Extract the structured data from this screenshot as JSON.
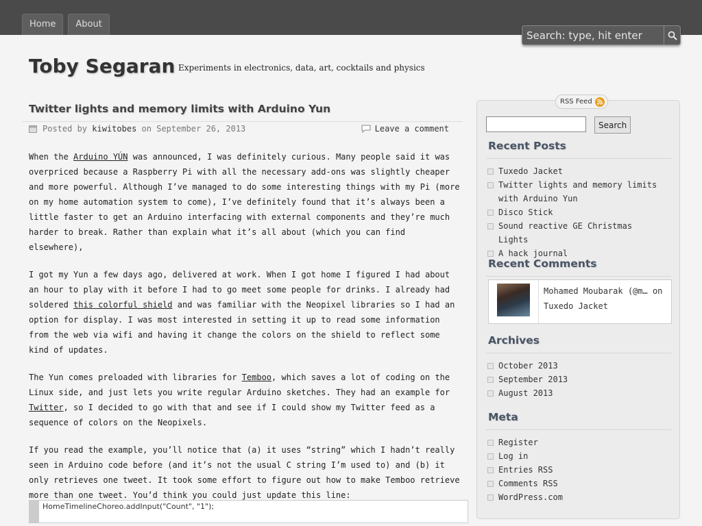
{
  "nav": {
    "tabs": [
      "Home",
      "About"
    ]
  },
  "search": {
    "placeholder": "Search: type, hit enter"
  },
  "site": {
    "title": "Toby Segaran",
    "tagline": "Experiments in electronics, data, art, cocktails and physics"
  },
  "post": {
    "title": "Twitter lights and memory limits with Arduino Yun",
    "meta": {
      "posted_by": "Posted by",
      "author": "kiwitobes",
      "on": "on",
      "date": "September 26, 2013",
      "comment": "Leave a comment"
    },
    "p1": {
      "a": "When the ",
      "link": "Arduino YÚN",
      "b": " was announced, I was definitely curious. Many people said it was overpriced because a Raspberry Pi with all the necessary add-ons was slightly cheaper and more powerful.  Although I’ve managed to do some interesting things with my Pi (more on my home automation system to come), I’ve definitely found that it’s always been a little faster to get an Arduino interfacing with external components and they’re much harder to break. Rather than explain what it’s all about (which you can find elsewhere),"
    },
    "p2": {
      "a": "I got my Yun a few days ago, delivered at work. When I got home I figured I had about an hour to play with it before I had to go meet some people for drinks. I already had soldered ",
      "link": "this colorful shield",
      "b": " and was familiar with the Neopixel libraries so I had an option for display. I was most interested in setting it up to read some information from the web via wifi and having it change the colors on the shield to reflect some kind of updates."
    },
    "p3": {
      "a": "The Yun comes preloaded with libraries for ",
      "link1": "Temboo",
      "b": ", which saves a lot of coding on the Linux side, and just lets you write regular Arduino sketches. They had an example for ",
      "link2": "Twitter",
      "c": ", so I decided to go with that and see if I could show my Twitter feed as a sequence of colors on the Neopixels."
    },
    "p4": "If you read the example, you’ll notice that (a) it uses “string” which I hadn’t really seen in Arduino code before (and it’s not the usual C string I’m used to) and (b) it only retrieves one tweet. It took some effort to figure out how to make Temboo retrieve more than one tweet. You’d think you could just update this line:",
    "code": "HomeTimelineChoreo.addInput(\"Count\", \"1\");"
  },
  "sidebar": {
    "rss_label": "RSS Feed",
    "search_button": "Search",
    "recent_posts_title": "Recent Posts",
    "recent_posts": [
      "Tuxedo Jacket",
      "Twitter lights and memory limits with Arduino Yun",
      "Disco Stick",
      "Sound reactive GE Christmas Lights",
      "A hack journal"
    ],
    "recent_comments_title": "Recent Comments",
    "recent_comment": {
      "author": "Mohamed Moubarak (@m…",
      "on": "on",
      "post": "Tuxedo Jacket"
    },
    "archives_title": "Archives",
    "archives": [
      "October 2013",
      "September 2013",
      "August 2013"
    ],
    "meta_title": "Meta",
    "meta": [
      "Register",
      "Log in",
      "Entries RSS",
      "Comments RSS",
      "WordPress.com"
    ]
  },
  "colors": {
    "topbar": "#4a4a4a",
    "rss_orange": "#e8a020"
  }
}
